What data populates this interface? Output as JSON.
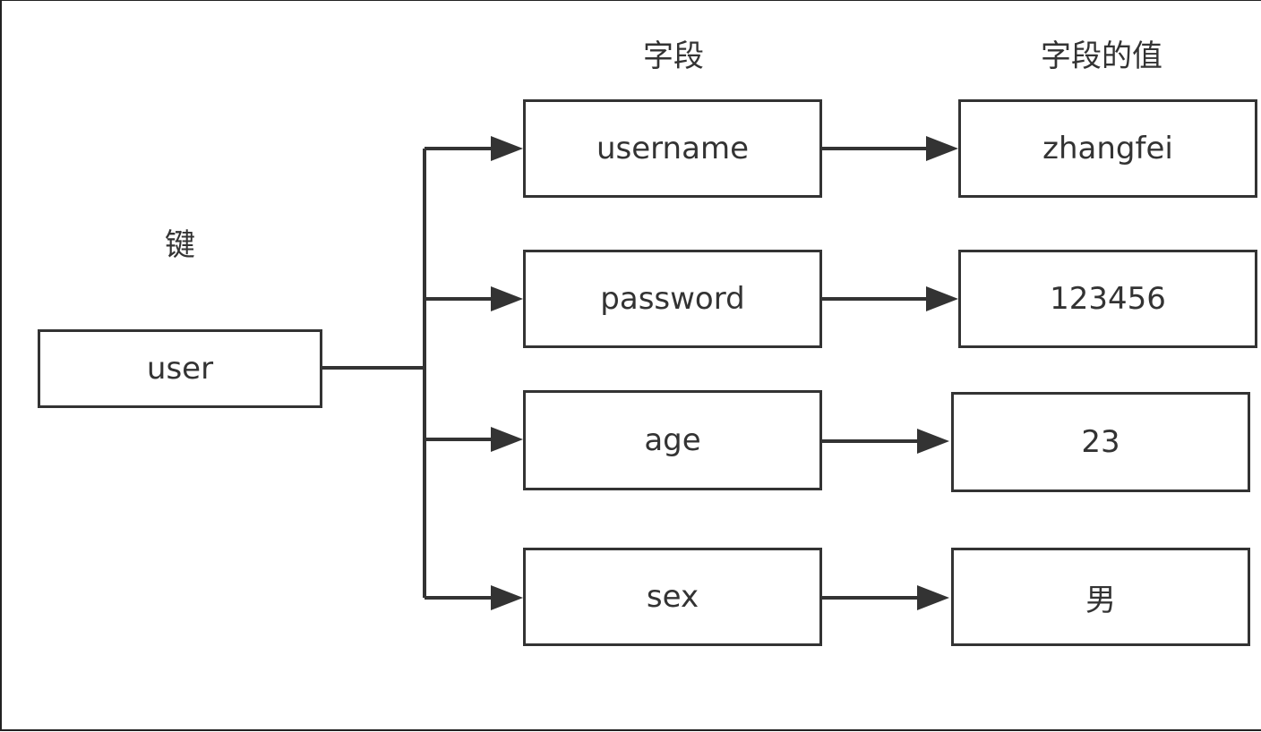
{
  "headings": {
    "key": "键",
    "field": "字段",
    "value": "字段的值"
  },
  "key": "user",
  "rows": [
    {
      "field": "username",
      "value": "zhangfei"
    },
    {
      "field": "password",
      "value": "123456"
    },
    {
      "field": "age",
      "value": "23"
    },
    {
      "field": "sex",
      "value": "男"
    }
  ]
}
